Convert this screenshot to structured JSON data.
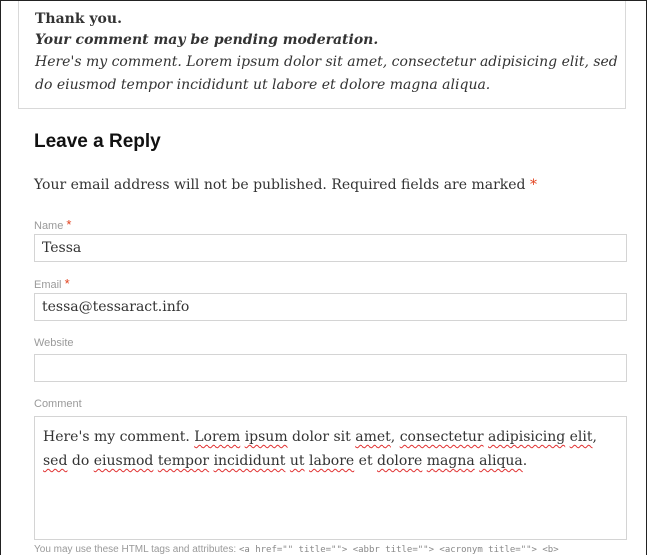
{
  "comment": {
    "thanks": "Thank you.",
    "pending": "Your comment may be pending moderation.",
    "text": "Here's my comment. Lorem ipsum dolor sit amet, consectetur adipisicing elit, sed do eiusmod tempor incididunt ut labore et dolore magna aliqua."
  },
  "reply": {
    "title": "Leave a Reply",
    "notes": "Your email address will not be published. Required fields are marked",
    "required_mark": "*"
  },
  "form": {
    "name_label": "Name",
    "name_value": "Tessa",
    "email_label": "Email",
    "email_value": "tessa@tessaract.info",
    "website_label": "Website",
    "website_value": "",
    "comment_label": "Comment",
    "comment_words": [
      {
        "t": "Here's my comment. ",
        "s": false
      },
      {
        "t": "Lorem",
        "s": true
      },
      {
        "t": " ",
        "s": false
      },
      {
        "t": "ipsum",
        "s": true
      },
      {
        "t": " dolor sit ",
        "s": false
      },
      {
        "t": "amet",
        "s": true
      },
      {
        "t": ", ",
        "s": false
      },
      {
        "t": "consectetur",
        "s": true
      },
      {
        "t": " ",
        "s": false
      },
      {
        "t": "adipisicing",
        "s": true
      },
      {
        "t": " ",
        "s": false
      },
      {
        "t": "elit",
        "s": true
      },
      {
        "t": ", ",
        "s": false
      },
      {
        "t": "sed",
        "s": true
      },
      {
        "t": " do ",
        "s": false
      },
      {
        "t": "eiusmod",
        "s": true
      },
      {
        "t": " ",
        "s": false
      },
      {
        "t": "tempor",
        "s": true
      },
      {
        "t": " ",
        "s": false
      },
      {
        "t": "incididunt",
        "s": true
      },
      {
        "t": " ",
        "s": false
      },
      {
        "t": "ut",
        "s": true
      },
      {
        "t": " ",
        "s": false
      },
      {
        "t": "labore",
        "s": true
      },
      {
        "t": " et ",
        "s": false
      },
      {
        "t": "dolore",
        "s": true
      },
      {
        "t": " ",
        "s": false
      },
      {
        "t": "magna",
        "s": true
      },
      {
        "t": " ",
        "s": false
      },
      {
        "t": "aliqua",
        "s": true
      },
      {
        "t": ".",
        "s": false
      }
    ],
    "allowed_tags_prefix": "You may use these HTML tags and attributes:",
    "allowed_tags_code": "<a href=\"\" title=\"\"> <abbr title=\"\"> <acronym title=\"\"> <b>"
  }
}
